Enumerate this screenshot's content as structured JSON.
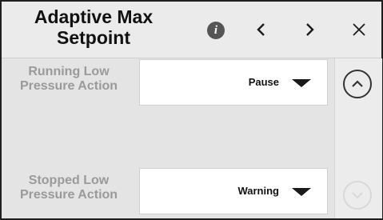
{
  "header": {
    "title": "Adaptive Max Setpoint",
    "info_icon": "info-icon",
    "prev_icon": "chevron-left-icon",
    "next_icon": "chevron-right-icon",
    "close_icon": "close-icon"
  },
  "settings": [
    {
      "label": "Running Low Pressure Action",
      "value": "Pause"
    },
    {
      "label": "Stopped Low Pressure Action",
      "value": "Warning"
    }
  ],
  "scroll": {
    "up_icon": "chevron-up-icon",
    "down_icon": "chevron-down-icon",
    "up_enabled": true,
    "down_enabled": false
  },
  "colors": {
    "label_text": "#9a9a9a",
    "icon_dark": "#333333",
    "icon_disabled": "#d8d8d8"
  }
}
